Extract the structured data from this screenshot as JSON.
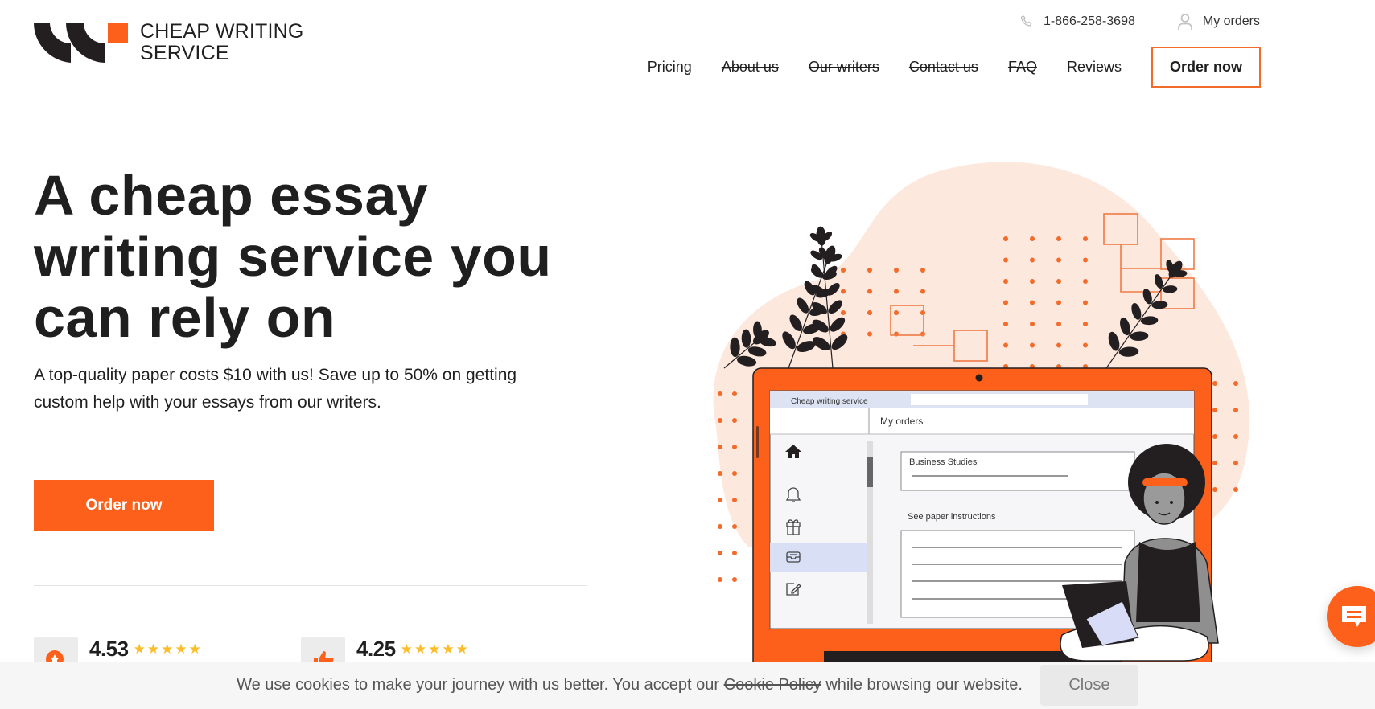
{
  "brand": {
    "name_line1": "Cheap Writing",
    "name_line2": "Service",
    "accent_color": "#fd601a",
    "dark_color": "#231f20"
  },
  "topbar": {
    "phone": "1-866-258-3698",
    "phone_icon": "phone-icon",
    "my_orders": "My orders",
    "user_icon": "user-icon"
  },
  "nav": {
    "items": [
      {
        "label": "Pricing",
        "strikethrough": false
      },
      {
        "label": "About us",
        "strikethrough": true
      },
      {
        "label": "Our writers",
        "strikethrough": true
      },
      {
        "label": "Contact us",
        "strikethrough": true
      },
      {
        "label": "FAQ",
        "strikethrough": true
      },
      {
        "label": "Reviews",
        "strikethrough": false
      }
    ],
    "order_button": "Order now"
  },
  "hero": {
    "title": "A cheap essay writing service you can rely on",
    "subtitle": "A top-quality paper costs $10 with us! Save up to 50% on getting custom help with your essays from our writers.",
    "cta": "Order now"
  },
  "ratings": [
    {
      "value": "4.53",
      "stars": "★★★★★",
      "icon": "star-badge-icon"
    },
    {
      "value": "4.25",
      "stars": "★★★★★",
      "icon": "thumbs-up-icon"
    }
  ],
  "illustration": {
    "app_title": "Cheap writing service",
    "page_title": "My orders",
    "order_subject": "Business Studies",
    "instructions_label": "See paper instructions",
    "sidebar_icons": [
      "home-icon",
      "bell-icon",
      "gift-icon",
      "inbox-icon",
      "edit-icon"
    ]
  },
  "cookie": {
    "text_before": "We use cookies to make your journey with us better. You accept our",
    "policy_link": "Cookie Policy",
    "text_after": "while browsing our website.",
    "close": "Close"
  },
  "chat": {
    "icon": "chat-icon"
  }
}
